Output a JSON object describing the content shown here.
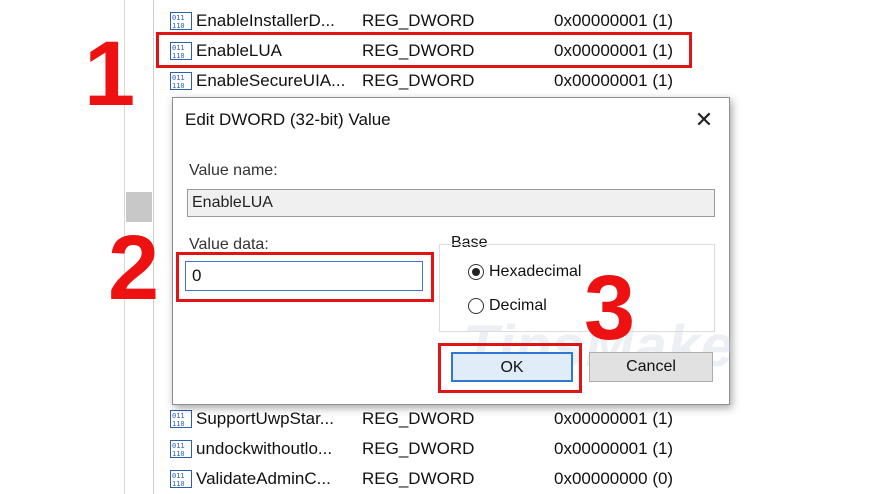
{
  "registry_rows_top": [
    {
      "name": "EnableInstallerD...",
      "type": "REG_DWORD",
      "data": "0x00000001 (1)"
    },
    {
      "name": "EnableLUA",
      "type": "REG_DWORD",
      "data": "0x00000001 (1)"
    },
    {
      "name": "EnableSecureUIA...",
      "type": "REG_DWORD",
      "data": "0x00000001 (1)"
    }
  ],
  "registry_rows_bottom": [
    {
      "name": "SupportUwpStar...",
      "type": "REG_DWORD",
      "data": "0x00000001 (1)"
    },
    {
      "name": "undockwithoutlo...",
      "type": "REG_DWORD",
      "data": "0x00000001 (1)"
    },
    {
      "name": "ValidateAdminC...",
      "type": "REG_DWORD",
      "data": "0x00000000 (0)"
    }
  ],
  "dialog": {
    "title": "Edit DWORD (32-bit) Value",
    "close": "✕",
    "value_name_label": "Value name:",
    "value_name": "EnableLUA",
    "value_data_label": "Value data:",
    "value_data": "0",
    "base_label": "Base",
    "hex_label": "Hexadecimal",
    "dec_label": "Decimal",
    "base_selected": "Hexadecimal",
    "ok_label": "OK",
    "cancel_label": "Cancel"
  },
  "annotations": {
    "step1": "1",
    "step2": "2",
    "step3": "3",
    "color": "#ee1111"
  },
  "watermark": "TipsMake",
  "icons": {
    "row_icon": "reg-dword-icon",
    "close": "close-icon"
  }
}
